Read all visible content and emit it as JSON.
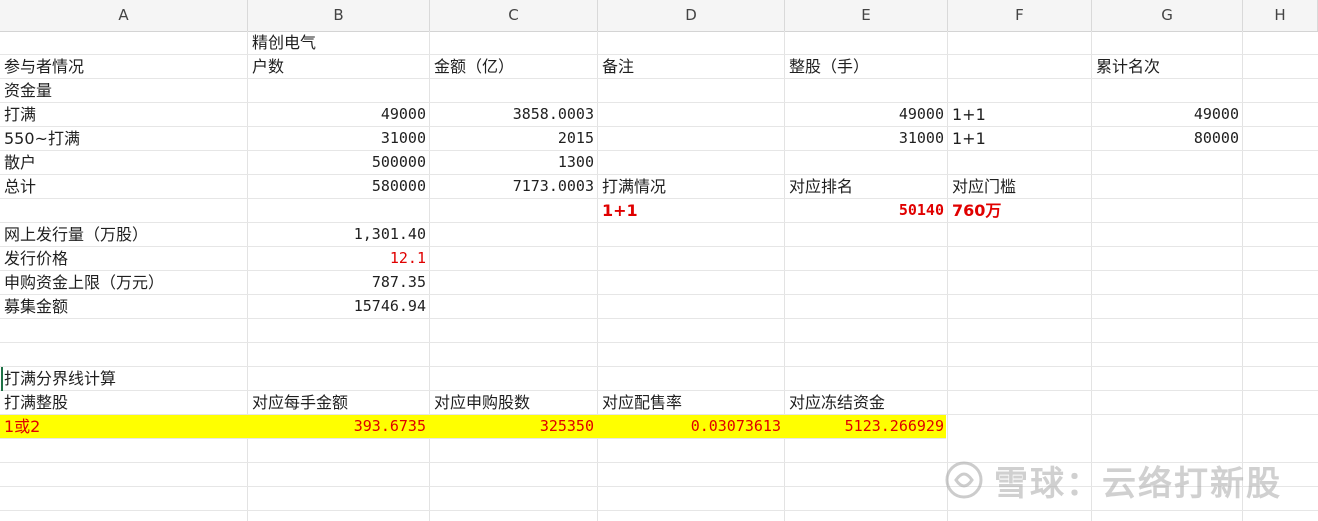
{
  "columns": [
    "A",
    "B",
    "C",
    "D",
    "E",
    "F",
    "G",
    "H"
  ],
  "rows": [
    {
      "cells": [
        null,
        {
          "t": "精创电气"
        },
        null,
        null,
        null,
        null,
        null,
        null
      ]
    },
    {
      "cells": [
        {
          "t": "参与者情况"
        },
        {
          "t": "户数"
        },
        {
          "t": "金额（亿）"
        },
        {
          "t": "备注"
        },
        {
          "t": "整股（手）"
        },
        null,
        {
          "t": "累计名次"
        },
        null
      ]
    },
    {
      "cells": [
        {
          "t": "资金量"
        },
        null,
        null,
        null,
        null,
        null,
        null,
        null
      ]
    },
    {
      "cells": [
        {
          "t": "打满"
        },
        {
          "t": "49000",
          "num": true
        },
        {
          "t": "3858.0003",
          "num": true
        },
        null,
        {
          "t": "49000",
          "num": true
        },
        {
          "t": "1+1"
        },
        {
          "t": "49000",
          "num": true
        },
        null
      ]
    },
    {
      "cells": [
        {
          "t": "550~打满"
        },
        {
          "t": "31000",
          "num": true
        },
        {
          "t": "2015",
          "num": true
        },
        null,
        {
          "t": "31000",
          "num": true
        },
        {
          "t": "1+1"
        },
        {
          "t": "80000",
          "num": true
        },
        null
      ]
    },
    {
      "cells": [
        {
          "t": "散户"
        },
        {
          "t": "500000",
          "num": true
        },
        {
          "t": "1300",
          "num": true
        },
        null,
        null,
        null,
        null,
        null
      ]
    },
    {
      "cells": [
        {
          "t": "总计"
        },
        {
          "t": "580000",
          "num": true
        },
        {
          "t": "7173.0003",
          "num": true
        },
        {
          "t": "打满情况"
        },
        {
          "t": "对应排名"
        },
        {
          "t": "对应门槛"
        },
        null,
        null
      ]
    },
    {
      "cells": [
        null,
        null,
        null,
        {
          "t": "1+1",
          "red": true,
          "bold": true
        },
        {
          "t": "50140",
          "num": true,
          "red": true,
          "bold": true
        },
        {
          "t": "760万",
          "red": true,
          "bold": true
        },
        null,
        null
      ]
    },
    {
      "cells": [
        {
          "t": "网上发行量（万股）"
        },
        {
          "t": "1,301.40",
          "num": true
        },
        null,
        null,
        null,
        null,
        null,
        null
      ]
    },
    {
      "cells": [
        {
          "t": "发行价格"
        },
        {
          "t": "12.1",
          "num": true,
          "red": true
        },
        null,
        null,
        null,
        null,
        null,
        null
      ]
    },
    {
      "cells": [
        {
          "t": "申购资金上限（万元）"
        },
        {
          "t": "787.35",
          "num": true
        },
        null,
        null,
        null,
        null,
        null,
        null
      ]
    },
    {
      "cells": [
        {
          "t": "募集金额"
        },
        {
          "t": "15746.94",
          "num": true
        },
        null,
        null,
        null,
        null,
        null,
        null
      ]
    },
    {
      "cells": [
        null,
        null,
        null,
        null,
        null,
        null,
        null,
        null
      ]
    },
    {
      "cells": [
        null,
        null,
        null,
        null,
        null,
        null,
        null,
        null
      ]
    },
    {
      "cells": [
        {
          "t": "打满分界线计算"
        },
        null,
        null,
        null,
        null,
        null,
        null,
        null
      ]
    },
    {
      "cells": [
        {
          "t": "打满整股"
        },
        {
          "t": "对应每手金额"
        },
        {
          "t": "对应申购股数"
        },
        {
          "t": "对应配售率"
        },
        {
          "t": "对应冻结资金"
        },
        null,
        null,
        null
      ]
    },
    {
      "highlight": true,
      "cells": [
        {
          "t": "1或2",
          "red": true
        },
        {
          "t": "393.6735",
          "num": true,
          "red": true
        },
        {
          "t": "325350",
          "num": true,
          "red": true
        },
        {
          "t": "0.03073613",
          "num": true,
          "red": true
        },
        {
          "t": "5123.266929",
          "num": true,
          "red": true
        },
        null,
        null,
        null
      ]
    },
    {
      "cells": [
        null,
        null,
        null,
        null,
        null,
        null,
        null,
        null
      ]
    },
    {
      "cells": [
        null,
        null,
        null,
        null,
        null,
        null,
        null,
        null
      ]
    },
    {
      "cells": [
        null,
        null,
        null,
        null,
        null,
        null,
        null,
        null
      ]
    }
  ],
  "watermark": {
    "text": "雪球：云络打新股",
    "logo_icon": "snowball-logo-icon"
  }
}
